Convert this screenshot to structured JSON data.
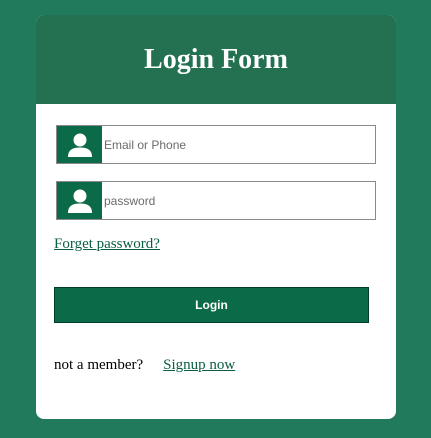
{
  "header": {
    "title": "Login Form"
  },
  "form": {
    "email": {
      "placeholder": "Email or Phone",
      "value": "",
      "icon": "user-icon"
    },
    "password": {
      "placeholder": "password",
      "value": "",
      "icon": "user-icon"
    },
    "forget_label": "Forget password?",
    "login_label": "Login",
    "signup_prompt": "not a member?",
    "signup_label": "Signup now"
  },
  "colors": {
    "page_background": "#217a5b",
    "header_background": "#247152",
    "accent": "#0b6a48",
    "link": "#0b5e40"
  }
}
